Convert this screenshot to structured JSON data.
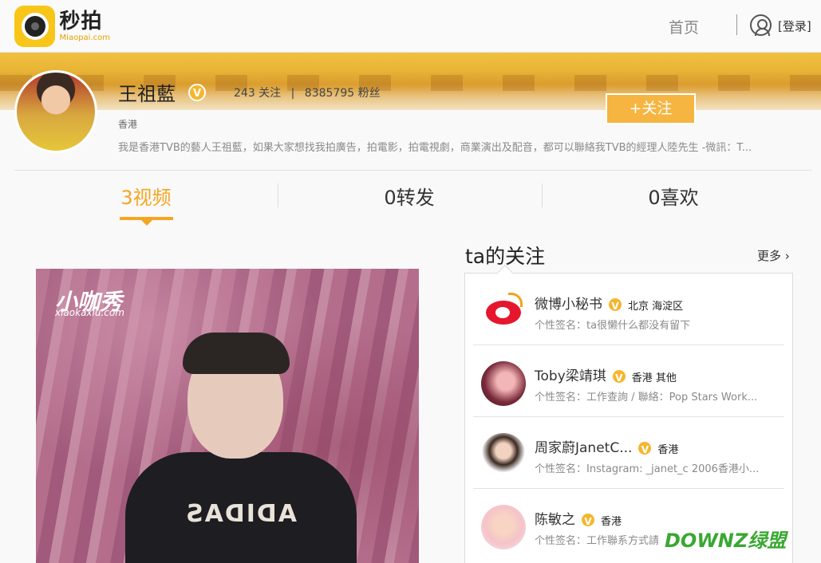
{
  "header": {
    "logo_cn": "秒拍",
    "logo_en": "Miaopai.com",
    "home_label": "首页",
    "login_label": "[登录]"
  },
  "profile": {
    "name": "王祖藍",
    "verified_badge": "V",
    "following": "243 关注",
    "followers": "8385795 粉丝",
    "stats_separator": "|",
    "follow_button": "+关注",
    "location": "香港",
    "bio": "我是香港TVB的藝人王祖藍，如果大家想找我拍廣告，拍電影，拍電視劇，商業演出及配音，都可以聯絡我TVB的經理人陸先生 -微訊：T..."
  },
  "tabs": [
    {
      "label": "3视频",
      "active": true
    },
    {
      "label": "0转发",
      "active": false
    },
    {
      "label": "0喜欢",
      "active": false
    }
  ],
  "video": {
    "watermark_cn": "小咖秀",
    "watermark_en": "xiaokaxiu.com",
    "shirt_text": "ADIDAS"
  },
  "following_panel": {
    "title": "ta的关注",
    "more_label": "更多 ›",
    "items": [
      {
        "name": "微博小秘书",
        "location": "北京 海淀区",
        "signature": "个性签名：ta很懒什么都没有留下"
      },
      {
        "name": "Toby梁靖琪",
        "location": "香港 其他",
        "signature": "个性签名：工作查詢 / 聯絡：Pop Stars Work..."
      },
      {
        "name": "周家蔚JanetC...",
        "location": "香港",
        "signature": "个性签名：Instagram: _janet_c 2006香港小..."
      },
      {
        "name": "陈敏之",
        "location": "香港",
        "signature": "个性签名：工作聯系方式請"
      }
    ]
  },
  "site_watermark": "DOWNZ绿盟",
  "colors": {
    "accent": "#f4a623",
    "verified": "#f5b62f",
    "follow_button": "#f5b540"
  }
}
